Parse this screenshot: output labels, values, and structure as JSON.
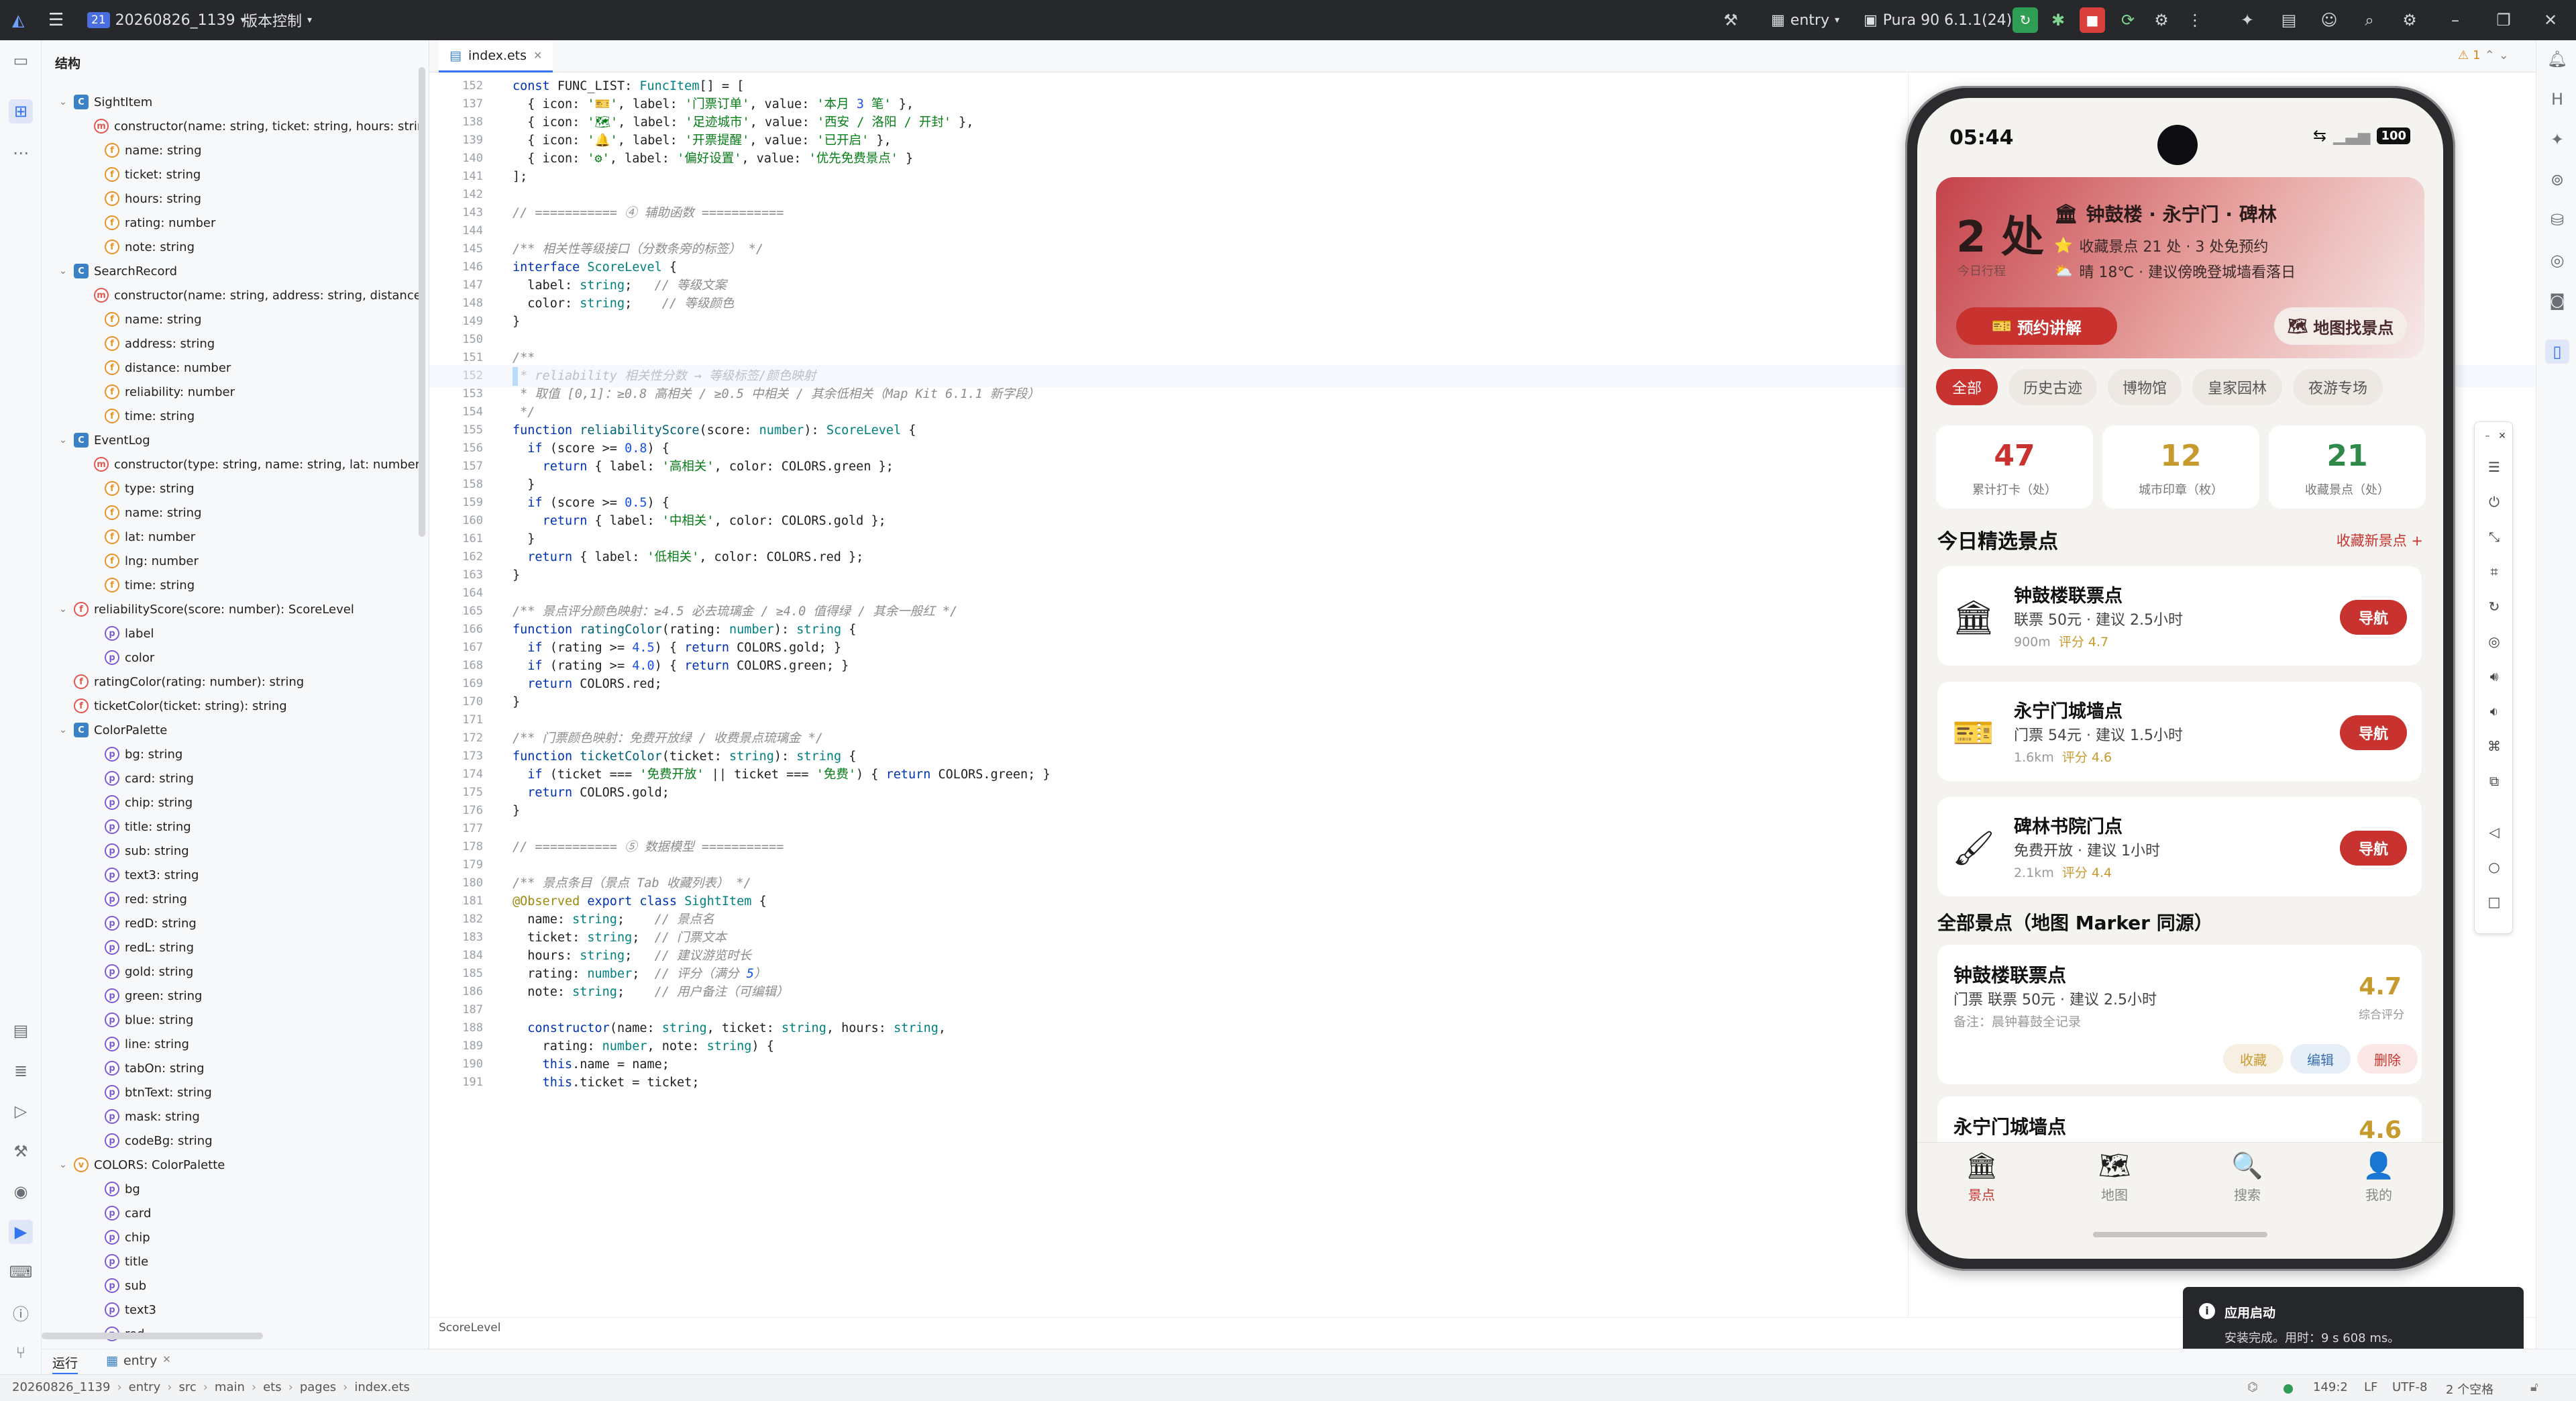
{
  "topbar": {
    "project_badge": "21",
    "project_name": "20260826_1139",
    "vcs": "版本控制",
    "module": "entry",
    "device": "Pura 90 6.1.1(24)"
  },
  "structure": {
    "title": "结构",
    "rows": [
      {
        "indent": 0,
        "chev": "⌄",
        "icon": "c",
        "icon_text": "C",
        "label": "SightItem"
      },
      {
        "indent": 1,
        "chev": "",
        "icon": "m",
        "icon_text": "m",
        "label": "constructor(name: string, ticket: string, hours: string, ra"
      },
      {
        "indent": 1,
        "chev": "",
        "icon": "f",
        "icon_text": "f",
        "label": "name: string"
      },
      {
        "indent": 1,
        "chev": "",
        "icon": "f",
        "icon_text": "f",
        "label": "ticket: string"
      },
      {
        "indent": 1,
        "chev": "",
        "icon": "f",
        "icon_text": "f",
        "label": "hours: string"
      },
      {
        "indent": 1,
        "chev": "",
        "icon": "f",
        "icon_text": "f",
        "label": "rating: number"
      },
      {
        "indent": 1,
        "chev": "",
        "icon": "f",
        "icon_text": "f",
        "label": "note: string"
      },
      {
        "indent": 0,
        "chev": "⌄",
        "icon": "c",
        "icon_text": "C",
        "label": "SearchRecord"
      },
      {
        "indent": 1,
        "chev": "",
        "icon": "m",
        "icon_text": "m",
        "label": "constructor(name: string, address: string, distance: nu"
      },
      {
        "indent": 1,
        "chev": "",
        "icon": "f",
        "icon_text": "f",
        "label": "name: string"
      },
      {
        "indent": 1,
        "chev": "",
        "icon": "f",
        "icon_text": "f",
        "label": "address: string"
      },
      {
        "indent": 1,
        "chev": "",
        "icon": "f",
        "icon_text": "f",
        "label": "distance: number"
      },
      {
        "indent": 1,
        "chev": "",
        "icon": "f",
        "icon_text": "f",
        "label": "reliability: number"
      },
      {
        "indent": 1,
        "chev": "",
        "icon": "f",
        "icon_text": "f",
        "label": "time: string"
      },
      {
        "indent": 0,
        "chev": "⌄",
        "icon": "c",
        "icon_text": "C",
        "label": "EventLog"
      },
      {
        "indent": 1,
        "chev": "",
        "icon": "m",
        "icon_text": "m",
        "label": "constructor(type: string, name: string, lat: number, lng"
      },
      {
        "indent": 1,
        "chev": "",
        "icon": "f",
        "icon_text": "f",
        "label": "type: string"
      },
      {
        "indent": 1,
        "chev": "",
        "icon": "f",
        "icon_text": "f",
        "label": "name: string"
      },
      {
        "indent": 1,
        "chev": "",
        "icon": "f",
        "icon_text": "f",
        "label": "lat: number"
      },
      {
        "indent": 1,
        "chev": "",
        "icon": "f",
        "icon_text": "f",
        "label": "lng: number"
      },
      {
        "indent": 1,
        "chev": "",
        "icon": "f",
        "icon_text": "f",
        "label": "time: string"
      },
      {
        "indent": 0,
        "chev": "⌄",
        "icon": "m",
        "icon_text": "f",
        "label": "reliabilityScore(score: number): ScoreLevel"
      },
      {
        "indent": 1,
        "chev": "",
        "icon": "p",
        "icon_text": "p",
        "label": "label"
      },
      {
        "indent": 1,
        "chev": "",
        "icon": "p",
        "icon_text": "p",
        "label": "color"
      },
      {
        "indent": 0,
        "chev": "",
        "icon": "m",
        "icon_text": "f",
        "label": "ratingColor(rating: number): string"
      },
      {
        "indent": 0,
        "chev": "",
        "icon": "m",
        "icon_text": "f",
        "label": "ticketColor(ticket: string): string"
      },
      {
        "indent": 0,
        "chev": "⌄",
        "icon": "c",
        "icon_text": "C",
        "label": "ColorPalette"
      },
      {
        "indent": 1,
        "chev": "",
        "icon": "p",
        "icon_text": "p",
        "label": "bg: string"
      },
      {
        "indent": 1,
        "chev": "",
        "icon": "p",
        "icon_text": "p",
        "label": "card: string"
      },
      {
        "indent": 1,
        "chev": "",
        "icon": "p",
        "icon_text": "p",
        "label": "chip: string"
      },
      {
        "indent": 1,
        "chev": "",
        "icon": "p",
        "icon_text": "p",
        "label": "title: string"
      },
      {
        "indent": 1,
        "chev": "",
        "icon": "p",
        "icon_text": "p",
        "label": "sub: string"
      },
      {
        "indent": 1,
        "chev": "",
        "icon": "p",
        "icon_text": "p",
        "label": "text3: string"
      },
      {
        "indent": 1,
        "chev": "",
        "icon": "p",
        "icon_text": "p",
        "label": "red: string"
      },
      {
        "indent": 1,
        "chev": "",
        "icon": "p",
        "icon_text": "p",
        "label": "redD: string"
      },
      {
        "indent": 1,
        "chev": "",
        "icon": "p",
        "icon_text": "p",
        "label": "redL: string"
      },
      {
        "indent": 1,
        "chev": "",
        "icon": "p",
        "icon_text": "p",
        "label": "gold: string"
      },
      {
        "indent": 1,
        "chev": "",
        "icon": "p",
        "icon_text": "p",
        "label": "green: string"
      },
      {
        "indent": 1,
        "chev": "",
        "icon": "p",
        "icon_text": "p",
        "label": "blue: string"
      },
      {
        "indent": 1,
        "chev": "",
        "icon": "p",
        "icon_text": "p",
        "label": "line: string"
      },
      {
        "indent": 1,
        "chev": "",
        "icon": "p",
        "icon_text": "p",
        "label": "tabOn: string"
      },
      {
        "indent": 1,
        "chev": "",
        "icon": "p",
        "icon_text": "p",
        "label": "btnText: string"
      },
      {
        "indent": 1,
        "chev": "",
        "icon": "p",
        "icon_text": "p",
        "label": "mask: string"
      },
      {
        "indent": 1,
        "chev": "",
        "icon": "p",
        "icon_text": "p",
        "label": "codeBg: string"
      },
      {
        "indent": 0,
        "chev": "⌄",
        "icon": "v",
        "icon_text": "v",
        "label": "COLORS: ColorPalette"
      },
      {
        "indent": 1,
        "chev": "",
        "icon": "p",
        "icon_text": "p",
        "label": "bg"
      },
      {
        "indent": 1,
        "chev": "",
        "icon": "p",
        "icon_text": "p",
        "label": "card"
      },
      {
        "indent": 1,
        "chev": "",
        "icon": "p",
        "icon_text": "p",
        "label": "chip"
      },
      {
        "indent": 1,
        "chev": "",
        "icon": "p",
        "icon_text": "p",
        "label": "title"
      },
      {
        "indent": 1,
        "chev": "",
        "icon": "p",
        "icon_text": "p",
        "label": "sub"
      },
      {
        "indent": 1,
        "chev": "",
        "icon": "p",
        "icon_text": "p",
        "label": "text3"
      },
      {
        "indent": 1,
        "chev": "",
        "icon": "p",
        "icon_text": "p",
        "label": "red"
      }
    ]
  },
  "editor": {
    "tab_label": "index.ets",
    "warning_count": "1",
    "breadcrumb": "ScoreLevel",
    "lines": [
      [
        "152",
        "const FUNC_LIST: FuncItem[] = ["
      ],
      [
        "137",
        "  { icon: '🎫', label: '门票订单', value: '本月 3 笔' },"
      ],
      [
        "138",
        "  { icon: '🗺', label: '足迹城市', value: '西安 / 洛阳 / 开封' },"
      ],
      [
        "139",
        "  { icon: '🔔', label: '开票提醒', value: '已开启' },"
      ],
      [
        "140",
        "  { icon: '⚙', label: '偏好设置', value: '优先免费景点' }"
      ],
      [
        "141",
        "];"
      ],
      [
        "142",
        ""
      ],
      [
        "143",
        "// =========== ④ 辅助函数 ==========="
      ],
      [
        "144",
        ""
      ],
      [
        "145",
        "/** 相关性等级接口（分数条旁的标签） */"
      ],
      [
        "146",
        "interface ScoreLevel {"
      ],
      [
        "147",
        "  label: string;   // 等级文案"
      ],
      [
        "148",
        "  color: string;    // 等级颜色"
      ],
      [
        "149",
        "}"
      ],
      [
        "150",
        ""
      ],
      [
        "151",
        "/**"
      ],
      [
        "152",
        " * reliability 相关性分数 → 等级标签/颜色映射"
      ],
      [
        "153",
        " * 取值 [0,1]：≥0.8 高相关 / ≥0.5 中相关 / 其余低相关（Map Kit 6.1.1 新字段）"
      ],
      [
        "154",
        " */"
      ],
      [
        "155",
        "function reliabilityScore(score: number): ScoreLevel {"
      ],
      [
        "156",
        "  if (score >= 0.8) {"
      ],
      [
        "157",
        "    return { label: '高相关', color: COLORS.green };"
      ],
      [
        "158",
        "  }"
      ],
      [
        "159",
        "  if (score >= 0.5) {"
      ],
      [
        "160",
        "    return { label: '中相关', color: COLORS.gold };"
      ],
      [
        "161",
        "  }"
      ],
      [
        "162",
        "  return { label: '低相关', color: COLORS.red };"
      ],
      [
        "163",
        "}"
      ],
      [
        "164",
        ""
      ],
      [
        "165",
        "/** 景点评分颜色映射：≥4.5 必去琉璃金 / ≥4.0 值得绿 / 其余一般红 */"
      ],
      [
        "166",
        "function ratingColor(rating: number): string {"
      ],
      [
        "167",
        "  if (rating >= 4.5) { return COLORS.gold; }"
      ],
      [
        "168",
        "  if (rating >= 4.0) { return COLORS.green; }"
      ],
      [
        "169",
        "  return COLORS.red;"
      ],
      [
        "170",
        "}"
      ],
      [
        "171",
        ""
      ],
      [
        "172",
        "/** 门票颜色映射：免费开放绿 / 收费景点琉璃金 */"
      ],
      [
        "173",
        "function ticketColor(ticket: string): string {"
      ],
      [
        "174",
        "  if (ticket === '免费开放' || ticket === '免费') { return COLORS.green; }"
      ],
      [
        "175",
        "  return COLORS.gold;"
      ],
      [
        "176",
        "}"
      ],
      [
        "177",
        ""
      ],
      [
        "178",
        "// =========== ⑤ 数据模型 ==========="
      ],
      [
        "179",
        ""
      ],
      [
        "180",
        "/** 景点条目（景点 Tab 收藏列表） */"
      ],
      [
        "181",
        "@Observed export class SightItem {"
      ],
      [
        "182",
        "  name: string;    // 景点名"
      ],
      [
        "183",
        "  ticket: string;  // 门票文本"
      ],
      [
        "184",
        "  hours: string;   // 建议游览时长"
      ],
      [
        "185",
        "  rating: number;  // 评分（满分 5）"
      ],
      [
        "186",
        "  note: string;    // 用户备注（可编辑）"
      ],
      [
        "187",
        ""
      ],
      [
        "188",
        "  constructor(name: string, ticket: string, hours: string,"
      ],
      [
        "189",
        "    rating: number, note: string) {"
      ],
      [
        "190",
        "    this.name = name;"
      ],
      [
        "191",
        "    this.ticket = ticket;"
      ]
    ]
  },
  "runbar": {
    "run_label": "运行",
    "entry_label": "entry"
  },
  "statusbar": {
    "crumbs": [
      "20260826_1139",
      "entry",
      "src",
      "main",
      "ets",
      "pages",
      "index.ets"
    ],
    "position": "149:2",
    "line_ending": "LF",
    "encoding": "UTF-8",
    "indent": "2 个空格"
  },
  "phone": {
    "time": "05:44",
    "battery": "100",
    "hero": {
      "count": "2 处",
      "count_sub": "今日行程",
      "title": "钟鼓楼 · 永宁门 · 碑林",
      "line1": "收藏景点 21 处 · 3 处免预约",
      "line2": "晴 18℃ · 建议傍晚登城墙看落日",
      "btn_primary": "预约讲解",
      "btn_secondary": "地图找景点"
    },
    "chips": [
      "全部",
      "历史古迹",
      "博物馆",
      "皇家园林",
      "夜游专场"
    ],
    "stats": [
      {
        "value": "47",
        "label": "累计打卡（处）",
        "color": "#c8332f"
      },
      {
        "value": "12",
        "label": "城市印章（枚）",
        "color": "#c79a2e"
      },
      {
        "value": "21",
        "label": "收藏景点（处）",
        "color": "#2f8a4a"
      }
    ],
    "section1_title": "今日精选景点",
    "section1_link": "收藏新景点 +",
    "picks": [
      {
        "icon": "🏛",
        "name": "钟鼓楼联票点",
        "sub": "联票 50元 · 建议 2.5小时",
        "dist": "900m",
        "score": "评分 4.7",
        "nav": "导航"
      },
      {
        "icon": "🎫",
        "name": "永宁门城墙点",
        "sub": "门票 54元 · 建议 1.5小时",
        "dist": "1.6km",
        "score": "评分 4.6",
        "nav": "导航"
      },
      {
        "icon": "🖌",
        "name": "碑林书院门点",
        "sub": "免费开放 · 建议 1小时",
        "dist": "2.1km",
        "score": "评分 4.4",
        "nav": "导航"
      }
    ],
    "section2_title": "全部景点（地图 Marker 同源）",
    "all": [
      {
        "name": "钟鼓楼联票点",
        "sub": "门票 联票 50元 · 建议 2.5小时",
        "note": "备注：晨钟暮鼓全记录",
        "score": "4.7",
        "score_label": "综合评分",
        "btn1": "收藏",
        "btn2": "编辑",
        "btn3": "删除"
      },
      {
        "name": "永宁门城墙点",
        "score": "4.6"
      }
    ],
    "tabs": [
      {
        "icon": "🏛",
        "label": "景点"
      },
      {
        "icon": "🗺",
        "label": "地图"
      },
      {
        "icon": "🔍",
        "label": "搜索"
      },
      {
        "icon": "👤",
        "label": "我的"
      }
    ]
  },
  "toast": {
    "title": "应用启动",
    "body": "安装完成。用时：9 s 608 ms。"
  }
}
